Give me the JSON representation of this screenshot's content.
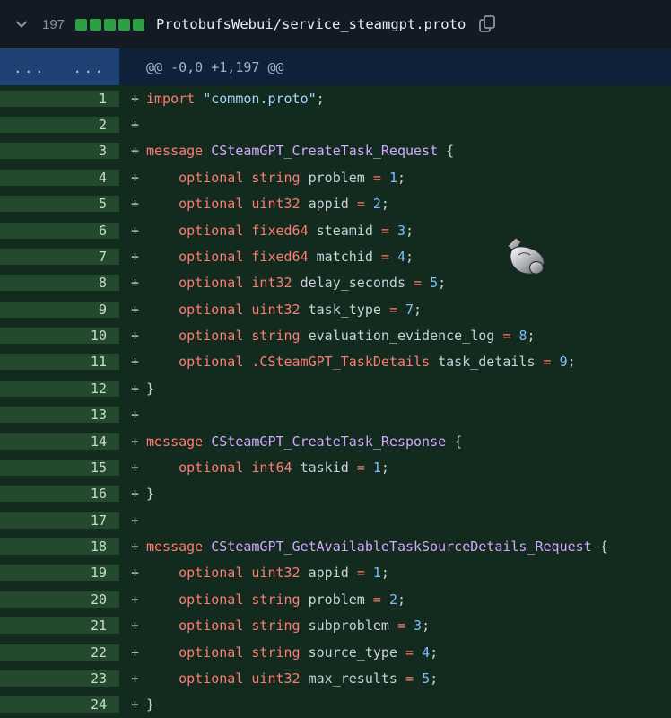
{
  "file_header": {
    "collapse_icon": "chevron-down",
    "changed_lines_count": "197",
    "diffstat_square_count": 5,
    "filename": "ProtobufsWebui/service_steamgpt.proto",
    "copy_icon": "copy"
  },
  "hunk": {
    "gutter_dots": [
      "...",
      "..."
    ],
    "header": "@@ -0,0 +1,197 @@"
  },
  "diff": {
    "lines": [
      {
        "num": 1,
        "sign": "+",
        "tokens": [
          [
            "k",
            "import"
          ],
          [
            "p",
            " "
          ],
          [
            "s",
            "\"common.proto\""
          ],
          [
            "p",
            ";"
          ]
        ]
      },
      {
        "num": 2,
        "sign": "+",
        "tokens": []
      },
      {
        "num": 3,
        "sign": "+",
        "tokens": [
          [
            "k",
            "message"
          ],
          [
            "p",
            " "
          ],
          [
            "t",
            "CSteamGPT_CreateTask_Request"
          ],
          [
            "p",
            " {"
          ]
        ]
      },
      {
        "num": 4,
        "sign": "+",
        "tokens": [
          [
            "p",
            "    "
          ],
          [
            "k",
            "optional"
          ],
          [
            "p",
            " "
          ],
          [
            "k",
            "string"
          ],
          [
            "p",
            " problem "
          ],
          [
            "o",
            "="
          ],
          [
            "p",
            " "
          ],
          [
            "n",
            "1"
          ],
          [
            "p",
            ";"
          ]
        ]
      },
      {
        "num": 5,
        "sign": "+",
        "tokens": [
          [
            "p",
            "    "
          ],
          [
            "k",
            "optional"
          ],
          [
            "p",
            " "
          ],
          [
            "k",
            "uint32"
          ],
          [
            "p",
            " appid "
          ],
          [
            "o",
            "="
          ],
          [
            "p",
            " "
          ],
          [
            "n",
            "2"
          ],
          [
            "p",
            ";"
          ]
        ]
      },
      {
        "num": 6,
        "sign": "+",
        "tokens": [
          [
            "p",
            "    "
          ],
          [
            "k",
            "optional"
          ],
          [
            "p",
            " "
          ],
          [
            "k",
            "fixed64"
          ],
          [
            "p",
            " steamid "
          ],
          [
            "o",
            "="
          ],
          [
            "p",
            " "
          ],
          [
            "n",
            "3"
          ],
          [
            "p",
            ";"
          ]
        ]
      },
      {
        "num": 7,
        "sign": "+",
        "tokens": [
          [
            "p",
            "    "
          ],
          [
            "k",
            "optional"
          ],
          [
            "p",
            " "
          ],
          [
            "k",
            "fixed64"
          ],
          [
            "p",
            " matchid "
          ],
          [
            "o",
            "="
          ],
          [
            "p",
            " "
          ],
          [
            "n",
            "4"
          ],
          [
            "p",
            ";"
          ]
        ]
      },
      {
        "num": 8,
        "sign": "+",
        "tokens": [
          [
            "p",
            "    "
          ],
          [
            "k",
            "optional"
          ],
          [
            "p",
            " "
          ],
          [
            "k",
            "int32"
          ],
          [
            "p",
            " delay_seconds "
          ],
          [
            "o",
            "="
          ],
          [
            "p",
            " "
          ],
          [
            "n",
            "5"
          ],
          [
            "p",
            ";"
          ]
        ]
      },
      {
        "num": 9,
        "sign": "+",
        "tokens": [
          [
            "p",
            "    "
          ],
          [
            "k",
            "optional"
          ],
          [
            "p",
            " "
          ],
          [
            "k",
            "uint32"
          ],
          [
            "p",
            " task_type "
          ],
          [
            "o",
            "="
          ],
          [
            "p",
            " "
          ],
          [
            "n",
            "7"
          ],
          [
            "p",
            ";"
          ]
        ]
      },
      {
        "num": 10,
        "sign": "+",
        "tokens": [
          [
            "p",
            "    "
          ],
          [
            "k",
            "optional"
          ],
          [
            "p",
            " "
          ],
          [
            "k",
            "string"
          ],
          [
            "p",
            " evaluation_evidence_log "
          ],
          [
            "o",
            "="
          ],
          [
            "p",
            " "
          ],
          [
            "n",
            "8"
          ],
          [
            "p",
            ";"
          ]
        ]
      },
      {
        "num": 11,
        "sign": "+",
        "tokens": [
          [
            "p",
            "    "
          ],
          [
            "k",
            "optional"
          ],
          [
            "p",
            " "
          ],
          [
            "k",
            ".CSteamGPT_TaskDetails"
          ],
          [
            "p",
            " task_details "
          ],
          [
            "o",
            "="
          ],
          [
            "p",
            " "
          ],
          [
            "n",
            "9"
          ],
          [
            "p",
            ";"
          ]
        ]
      },
      {
        "num": 12,
        "sign": "+",
        "tokens": [
          [
            "p",
            "}"
          ]
        ]
      },
      {
        "num": 13,
        "sign": "+",
        "tokens": []
      },
      {
        "num": 14,
        "sign": "+",
        "tokens": [
          [
            "k",
            "message"
          ],
          [
            "p",
            " "
          ],
          [
            "t",
            "CSteamGPT_CreateTask_Response"
          ],
          [
            "p",
            " {"
          ]
        ]
      },
      {
        "num": 15,
        "sign": "+",
        "tokens": [
          [
            "p",
            "    "
          ],
          [
            "k",
            "optional"
          ],
          [
            "p",
            " "
          ],
          [
            "k",
            "int64"
          ],
          [
            "p",
            " taskid "
          ],
          [
            "o",
            "="
          ],
          [
            "p",
            " "
          ],
          [
            "n",
            "1"
          ],
          [
            "p",
            ";"
          ]
        ]
      },
      {
        "num": 16,
        "sign": "+",
        "tokens": [
          [
            "p",
            "}"
          ]
        ]
      },
      {
        "num": 17,
        "sign": "+",
        "tokens": []
      },
      {
        "num": 18,
        "sign": "+",
        "tokens": [
          [
            "k",
            "message"
          ],
          [
            "p",
            " "
          ],
          [
            "t",
            "CSteamGPT_GetAvailableTaskSourceDetails_Request"
          ],
          [
            "p",
            " {"
          ]
        ]
      },
      {
        "num": 19,
        "sign": "+",
        "tokens": [
          [
            "p",
            "    "
          ],
          [
            "k",
            "optional"
          ],
          [
            "p",
            " "
          ],
          [
            "k",
            "uint32"
          ],
          [
            "p",
            " appid "
          ],
          [
            "o",
            "="
          ],
          [
            "p",
            " "
          ],
          [
            "n",
            "1"
          ],
          [
            "p",
            ";"
          ]
        ]
      },
      {
        "num": 20,
        "sign": "+",
        "tokens": [
          [
            "p",
            "    "
          ],
          [
            "k",
            "optional"
          ],
          [
            "p",
            " "
          ],
          [
            "k",
            "string"
          ],
          [
            "p",
            " problem "
          ],
          [
            "o",
            "="
          ],
          [
            "p",
            " "
          ],
          [
            "n",
            "2"
          ],
          [
            "p",
            ";"
          ]
        ]
      },
      {
        "num": 21,
        "sign": "+",
        "tokens": [
          [
            "p",
            "    "
          ],
          [
            "k",
            "optional"
          ],
          [
            "p",
            " "
          ],
          [
            "k",
            "string"
          ],
          [
            "p",
            " subproblem "
          ],
          [
            "o",
            "="
          ],
          [
            "p",
            " "
          ],
          [
            "n",
            "3"
          ],
          [
            "p",
            ";"
          ]
        ]
      },
      {
        "num": 22,
        "sign": "+",
        "tokens": [
          [
            "p",
            "    "
          ],
          [
            "k",
            "optional"
          ],
          [
            "p",
            " "
          ],
          [
            "k",
            "string"
          ],
          [
            "p",
            " source_type "
          ],
          [
            "o",
            "="
          ],
          [
            "p",
            " "
          ],
          [
            "n",
            "4"
          ],
          [
            "p",
            ";"
          ]
        ]
      },
      {
        "num": 23,
        "sign": "+",
        "tokens": [
          [
            "p",
            "    "
          ],
          [
            "k",
            "optional"
          ],
          [
            "p",
            " "
          ],
          [
            "k",
            "uint32"
          ],
          [
            "p",
            " max_results "
          ],
          [
            "o",
            "="
          ],
          [
            "p",
            " "
          ],
          [
            "n",
            "5"
          ],
          [
            "p",
            ";"
          ]
        ]
      },
      {
        "num": 24,
        "sign": "+",
        "tokens": [
          [
            "p",
            "}"
          ]
        ]
      }
    ]
  },
  "colors": {
    "header_bg": "#141a23",
    "diffstat_green": "#2ea043",
    "hunk_gutter_bg": "#1e4273",
    "hunk_bg": "#0f2138",
    "addition_gutter_bg": "#234a2c",
    "addition_line_bg": "#132a1e",
    "keyword": "#ff7b72",
    "type_name": "#d2a8ff",
    "string": "#a5d6ff",
    "number": "#79c0ff",
    "plain": "#c9d1d9",
    "muted": "#8b949e"
  }
}
